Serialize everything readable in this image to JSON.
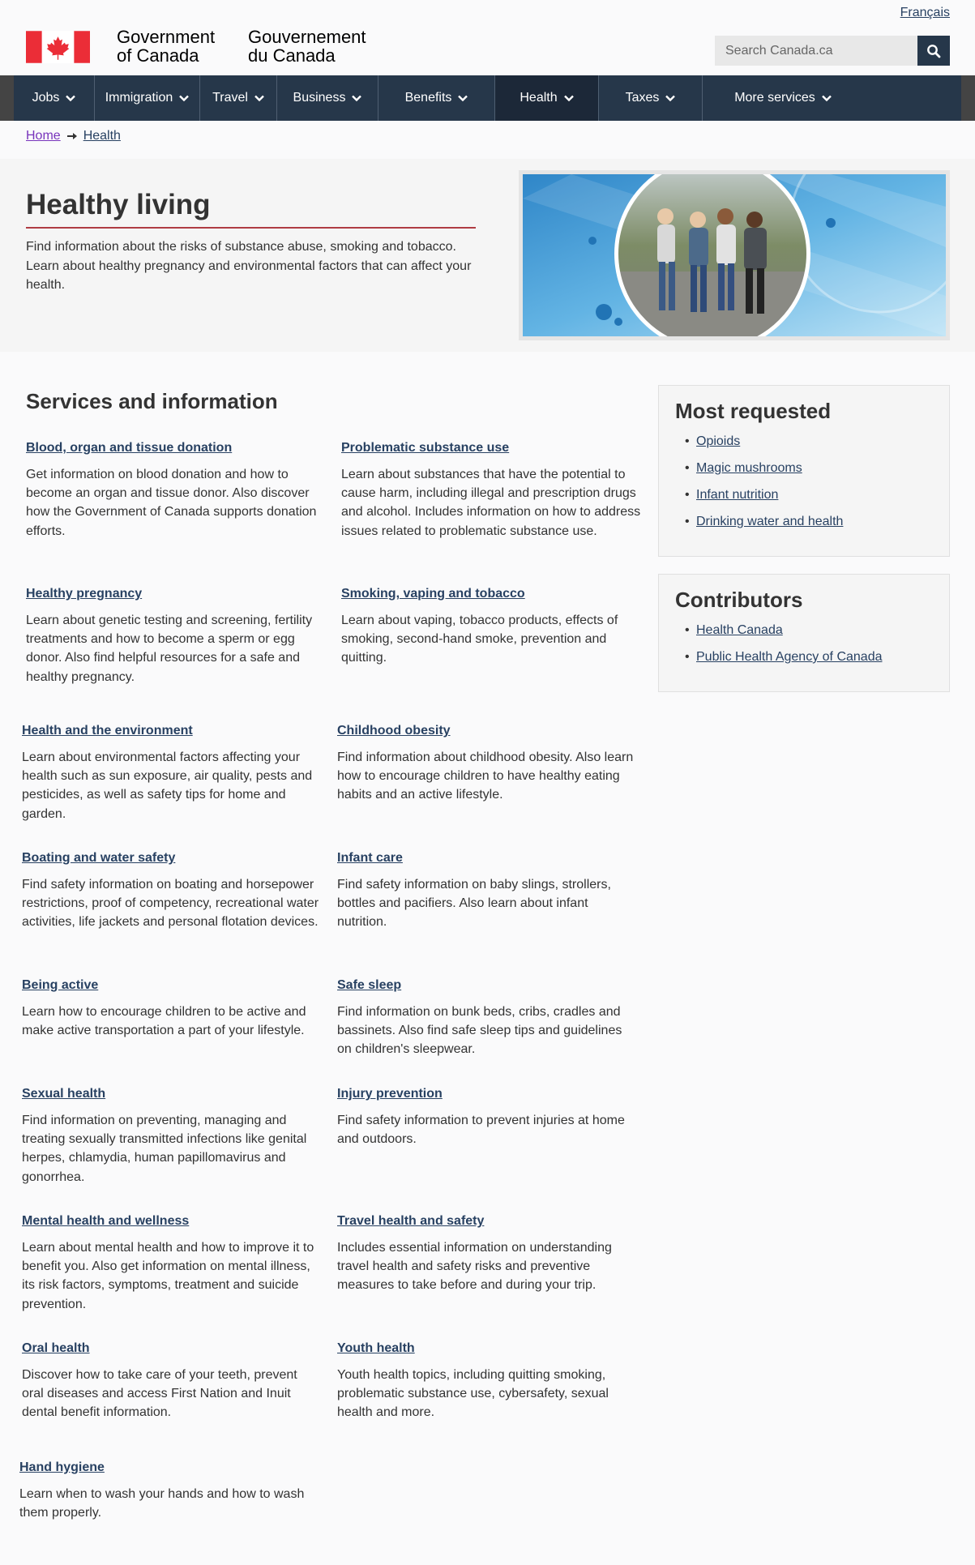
{
  "header": {
    "language_link": "Français",
    "signature_en": [
      "Government",
      "of Canada"
    ],
    "signature_fr": [
      "Gouvernement",
      "du Canada"
    ],
    "search_placeholder": "Search Canada.ca"
  },
  "nav": {
    "items": [
      {
        "label": "Jobs",
        "active": false
      },
      {
        "label": "Immigration",
        "active": false
      },
      {
        "label": "Travel",
        "active": false
      },
      {
        "label": "Business",
        "active": false
      },
      {
        "label": "Benefits",
        "active": false
      },
      {
        "label": "Health",
        "active": true
      },
      {
        "label": "Taxes",
        "active": false
      },
      {
        "label": "More services",
        "active": false
      }
    ]
  },
  "breadcrumb": {
    "home": "Home",
    "current": "Health"
  },
  "hero": {
    "title": "Healthy living",
    "lead": "Find information about the risks of substance abuse, smoking and tobacco. Learn about healthy pregnancy and environmental factors that can affect your health."
  },
  "services": {
    "title": "Services and information",
    "items": [
      {
        "title": "Blood, organ and tissue donation",
        "desc": "Get information on blood donation and how to become an organ and tissue donor. Also discover how the Government of Canada supports donation efforts."
      },
      {
        "title": "Problematic substance use",
        "desc": "Learn about substances that have the potential to cause harm, including illegal and prescription drugs and alcohol. Includes information on how to address issues related to problematic substance use."
      },
      {
        "title": "Healthy pregnancy",
        "desc": "Learn about genetic testing and screening, fertility treatments and how to become a sperm or egg donor. Also find helpful resources for a safe and healthy pregnancy."
      },
      {
        "title": "Smoking, vaping and tobacco",
        "desc": "Learn about vaping, tobacco products, effects of smoking, second-hand smoke, prevention and quitting."
      },
      {
        "title": "Health and the environment",
        "desc": "Learn about environmental factors affecting your health such as sun exposure, air quality, pests and pesticides, as well as safety tips for home and garden."
      },
      {
        "title": "Childhood obesity",
        "desc": "Find information about childhood obesity. Also learn how to encourage children to have healthy eating habits and an active lifestyle."
      },
      {
        "title": "Boating and water safety",
        "desc": "Find safety information on boating and horsepower restrictions, proof of competency, recreational water activities, life jackets and personal flotation devices."
      },
      {
        "title": "Infant care",
        "desc": "Find safety information on baby slings, strollers, bottles and pacifiers. Also learn about infant nutrition."
      },
      {
        "title": "Being active",
        "desc": "Learn how to encourage children to be active and make active transportation a part of your lifestyle."
      },
      {
        "title": "Safe sleep",
        "desc": "Find information on bunk beds, cribs, cradles and bassinets. Also find safe sleep tips and guidelines on children's sleepwear."
      },
      {
        "title": "Sexual health",
        "desc": "Find information on preventing, managing and treating sexually transmitted infections like genital herpes, chlamydia, human papillomavirus and gonorrhea."
      },
      {
        "title": "Injury prevention",
        "desc": "Find safety information to prevent injuries at home and outdoors."
      },
      {
        "title": "Mental health and wellness",
        "desc": "Learn about mental health and how to improve it to benefit you. Also get information on mental illness, its risk factors, symptoms, treatment and suicide prevention."
      },
      {
        "title": "Travel health and safety",
        "desc": "Includes essential information on understanding travel health and safety risks and preventive measures to take before and during your trip."
      },
      {
        "title": "Oral health",
        "desc": "Discover how to take care of your teeth, prevent oral diseases and access First Nation and Inuit dental benefit information."
      },
      {
        "title": "Youth health",
        "desc": "Youth health topics, including quitting smoking, problematic substance use, cybersafety, sexual health and more."
      },
      {
        "title": "Hand hygiene",
        "desc": "Learn when to wash your hands and how to wash them properly."
      }
    ]
  },
  "most_requested": {
    "title": "Most requested",
    "items": [
      "Opioids",
      "Magic mushrooms",
      "Infant nutrition",
      "Drinking water and health"
    ]
  },
  "contributors": {
    "title": "Contributors",
    "items": [
      "Health Canada",
      "Public Health Agency of Canada"
    ]
  },
  "colors": {
    "nav_bg": "#26374a",
    "nav_active": "#1c2838",
    "link": "#284162",
    "visited_link": "#7834bc",
    "accent_rule": "#af3c43",
    "flag_red": "#eb2d37"
  }
}
